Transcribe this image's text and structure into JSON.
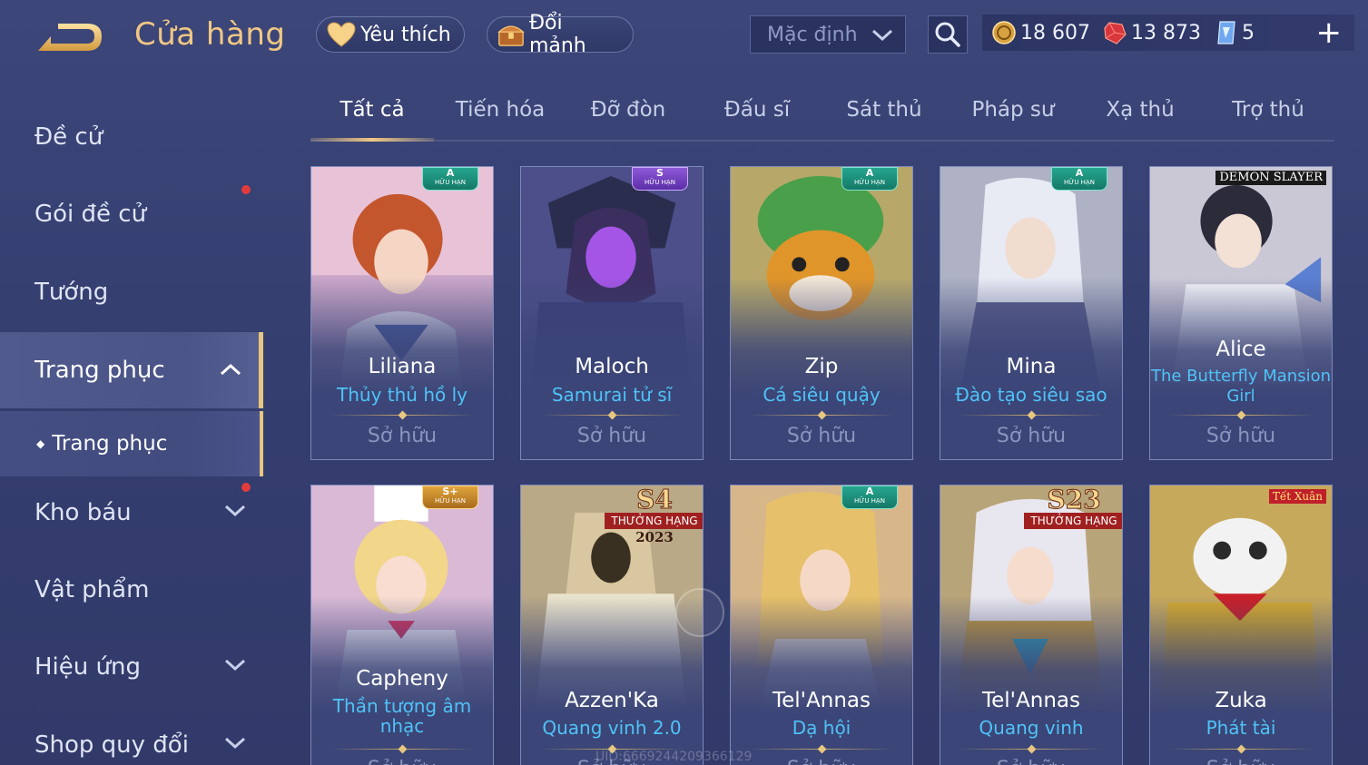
{
  "header": {
    "title": "Cửa hàng",
    "favorites_label": "Yêu thích",
    "exchange_label": "Đổi mảnh",
    "sort_selected": "Mặc định",
    "currency": {
      "gold": "18 607",
      "ruby": "13 873",
      "gem": "5"
    }
  },
  "sidebar": {
    "items": [
      {
        "label": "Đề cử"
      },
      {
        "label": "Gói đề cử"
      },
      {
        "label": "Tướng"
      },
      {
        "label": "Trang phục"
      },
      {
        "label": "Trang phục"
      },
      {
        "label": "Kho báu"
      },
      {
        "label": "Vật phẩm"
      },
      {
        "label": "Hiệu ứng"
      },
      {
        "label": "Shop quy đổi"
      }
    ]
  },
  "tabs": [
    "Tất cả",
    "Tiến hóa",
    "Đỡ đòn",
    "Đấu sĩ",
    "Sát thủ",
    "Pháp sư",
    "Xạ thủ",
    "Trợ thủ"
  ],
  "cards": [
    {
      "hero": "Liliana",
      "skin": "Thủy thủ hồ ly",
      "status": "Sở hữu",
      "badge_rank": "A",
      "badge_text": "HỮU HẠN"
    },
    {
      "hero": "Maloch",
      "skin": "Samurai tử sĩ",
      "status": "Sở hữu",
      "badge_rank": "S",
      "badge_text": "HỮU HẠN"
    },
    {
      "hero": "Zip",
      "skin": "Cá siêu quậy",
      "status": "Sở hữu",
      "badge_rank": "A",
      "badge_text": "HỮU HẠN"
    },
    {
      "hero": "Mina",
      "skin": "Đào tạo siêu sao",
      "status": "Sở hữu",
      "badge_rank": "A",
      "badge_text": "HỮU HẠN"
    },
    {
      "hero": "Alice",
      "skin": "The Butterfly Mansion Girl",
      "status": "Sở hữu",
      "tag": "DEMON SLAYER"
    },
    {
      "hero": "Capheny",
      "skin": "Thần tượng âm nhạc",
      "status": "Sở hữu",
      "badge_rank": "S+",
      "badge_text": "HỮU HẠN"
    },
    {
      "hero": "Azzen'Ka",
      "skin": "Quang vinh 2.0",
      "status": "Sở hữu",
      "rank_season": "S4",
      "rank_label": "THƯỞNG HẠNG",
      "rank_year": "2023"
    },
    {
      "hero": "Tel'Annas",
      "skin": "Dạ hội",
      "status": "Sở hữu",
      "badge_rank": "A",
      "badge_text": "HỮU HẠN"
    },
    {
      "hero": "Tel'Annas",
      "skin": "Quang vinh",
      "status": "Sở hữu",
      "rank_season": "S23",
      "rank_label": "THƯỞNG HẠNG"
    },
    {
      "hero": "Zuka",
      "skin": "Phát tài",
      "status": "Sở hữu",
      "tag": "Tết Xuân"
    }
  ],
  "uid_watermark": "UID:6669244209366129",
  "colors": {
    "accent_gold": "#f0c884",
    "skin_name_blue": "#4fc3f7",
    "background": "#353f70"
  }
}
